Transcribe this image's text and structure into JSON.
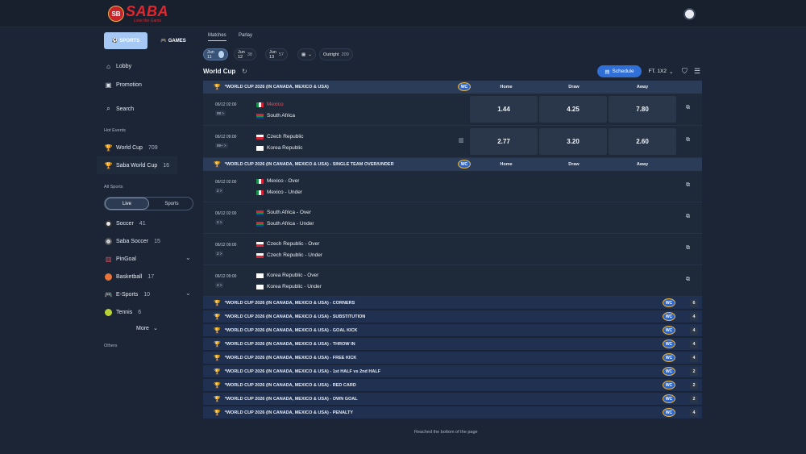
{
  "brand": {
    "name": "SABA",
    "tagline": "Love the Game",
    "mark": "SB"
  },
  "sidebar": {
    "top_buttons": {
      "sports": "SPORTS",
      "games": "GAMES"
    },
    "items": [
      {
        "label": "Lobby",
        "icon": "home-icon"
      },
      {
        "label": "Promotion",
        "icon": "gift-icon"
      },
      {
        "label": "Search",
        "icon": "search-icon"
      }
    ],
    "hot_events_label": "Hot Events",
    "hot_events": [
      {
        "label": "World Cup",
        "count": "709"
      },
      {
        "label": "Saba World Cup",
        "count": "16"
      }
    ],
    "all_sports_label": "All Sports",
    "toggle": {
      "live": "Live",
      "sports": "Sports"
    },
    "sports": [
      {
        "label": "Soccer",
        "count": "41"
      },
      {
        "label": "Saba Soccer",
        "count": "15"
      },
      {
        "label": "PinGoal",
        "count": ""
      },
      {
        "label": "Basketball",
        "count": "17"
      },
      {
        "label": "E-Sports",
        "count": "10"
      },
      {
        "label": "Tennis",
        "count": "6"
      }
    ],
    "more_label": "More",
    "others_label": "Others"
  },
  "tabs": [
    "Matches",
    "Parlay"
  ],
  "dates": [
    {
      "label": "Jun 11",
      "count": ""
    },
    {
      "label": "Jun 12",
      "count": "38"
    },
    {
      "label": "Jun 13",
      "count": "57"
    },
    {
      "label": "Outright",
      "count": "209"
    }
  ],
  "section_title": "World Cup",
  "schedule_label": "Schedule",
  "market_select": "FT. 1X2",
  "columns": {
    "home": "Home",
    "draw": "Draw",
    "away": "Away"
  },
  "wc_badge": "WC",
  "leagues": [
    {
      "title": "*WORLD CUP 2026 (IN CANADA, MEXICO & USA)"
    },
    {
      "title": "*WORLD CUP 2026 (IN CANADA, MEXICO & USA) - SINGLE TEAM OVER/UNDER"
    }
  ],
  "matches": [
    {
      "time": "06/12 02:00",
      "badge": "99 >",
      "home": "Mexico",
      "away": "South Africa",
      "odds": [
        "1.44",
        "4.25",
        "7.80"
      ]
    },
    {
      "time": "06/12 09:00",
      "badge": "99+ >",
      "home": "Czech Republic",
      "away": "Korea Republic",
      "odds": [
        "2.77",
        "3.20",
        "2.60"
      ]
    }
  ],
  "ou_matches": [
    {
      "time": "06/12 02:00",
      "badge": "2 >",
      "home": "Mexico - Over",
      "away": "Mexico - Under"
    },
    {
      "time": "06/12 02:00",
      "badge": "2 >",
      "home": "South Africa - Over",
      "away": "South Africa - Under"
    },
    {
      "time": "06/12 09:00",
      "badge": "2 >",
      "home": "Czech Republic - Over",
      "away": "Czech Republic - Under"
    },
    {
      "time": "06/12 09:00",
      "badge": "2 >",
      "home": "Korea Republic - Over",
      "away": "Korea Republic - Under"
    }
  ],
  "sub_markets": [
    {
      "title": "*WORLD CUP 2026 (IN CANADA, MEXICO & USA) - CORNERS",
      "count": "6"
    },
    {
      "title": "*WORLD CUP 2026 (IN CANADA, MEXICO & USA) - SUBSTITUTION",
      "count": "4"
    },
    {
      "title": "*WORLD CUP 2026 (IN CANADA, MEXICO & USA) - GOAL KICK",
      "count": "4"
    },
    {
      "title": "*WORLD CUP 2026 (IN CANADA, MEXICO & USA) - THROW IN",
      "count": "4"
    },
    {
      "title": "*WORLD CUP 2026 (IN CANADA, MEXICO & USA) - FREE KICK",
      "count": "4"
    },
    {
      "title": "*WORLD CUP 2026 (IN CANADA, MEXICO & USA) - 1st HALF vs 2nd HALF",
      "count": "2"
    },
    {
      "title": "*WORLD CUP 2026 (IN CANADA, MEXICO & USA) - RED CARD",
      "count": "2"
    },
    {
      "title": "*WORLD CUP 2026 (IN CANADA, MEXICO & USA) - OWN GOAL",
      "count": "2"
    },
    {
      "title": "*WORLD CUP 2026 (IN CANADA, MEXICO & USA) - PENALTY",
      "count": "4"
    }
  ],
  "bottom_note": "Reached the bottom of the page",
  "colors": {
    "accent": "#2f6fd6",
    "brand_red": "#e2262e",
    "header_row": "#2b3c58"
  }
}
